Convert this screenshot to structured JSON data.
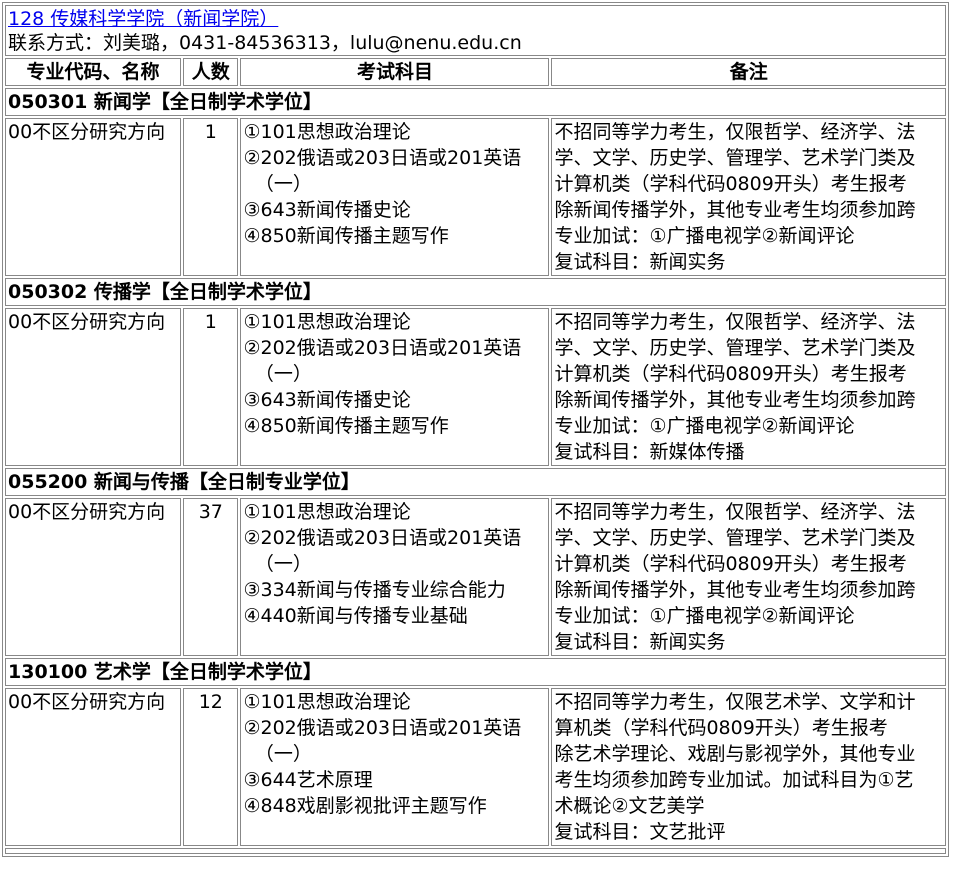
{
  "dept": {
    "link_text": "128 传媒科学学院（新闻学院）",
    "contact": "联系方式：刘美璐，0431-84536313，lulu@nenu.edu.cn"
  },
  "columns": [
    "专业代码、名称",
    "人数",
    "考试科目",
    "备注"
  ],
  "majors": [
    {
      "title": "050301 新闻学【全日制学术学位】",
      "direction": "00不区分研究方向",
      "count": "1",
      "subjects": [
        "①101思想政治理论",
        "②202俄语或203日语或201英语",
        "（一）",
        "③643新闻传播史论",
        "④850新闻传播主题写作"
      ],
      "notes": [
        "不招同等学力考生，仅限哲学、经济学、法",
        "学、文学、历史学、管理学、艺术学门类及",
        "计算机类（学科代码0809开头）考生报考",
        "除新闻传播学外，其他专业考生均须参加跨",
        "专业加试：①广播电视学②新闻评论",
        "复试科目：新闻实务"
      ]
    },
    {
      "title": "050302 传播学【全日制学术学位】",
      "direction": "00不区分研究方向",
      "count": "1",
      "subjects": [
        "①101思想政治理论",
        "②202俄语或203日语或201英语",
        "（一）",
        "③643新闻传播史论",
        "④850新闻传播主题写作"
      ],
      "notes": [
        "不招同等学力考生，仅限哲学、经济学、法",
        "学、文学、历史学、管理学、艺术学门类及",
        "计算机类（学科代码0809开头）考生报考",
        "除新闻传播学外，其他专业考生均须参加跨",
        "专业加试：①广播电视学②新闻评论",
        "复试科目：新媒体传播"
      ]
    },
    {
      "title": "055200 新闻与传播【全日制专业学位】",
      "direction": "00不区分研究方向",
      "count": "37",
      "subjects": [
        "①101思想政治理论",
        "②202俄语或203日语或201英语",
        "（一）",
        "③334新闻与传播专业综合能力",
        "④440新闻与传播专业基础"
      ],
      "notes": [
        "不招同等学力考生，仅限哲学、经济学、法",
        "学、文学、历史学、管理学、艺术学门类及",
        "计算机类（学科代码0809开头）考生报考",
        "除新闻传播学外，其他专业考生均须参加跨",
        "专业加试：①广播电视学②新闻评论",
        "复试科目：新闻实务"
      ]
    },
    {
      "title": "130100 艺术学【全日制学术学位】",
      "direction": "00不区分研究方向",
      "count": "12",
      "subjects": [
        "①101思想政治理论",
        "②202俄语或203日语或201英语",
        "（一）",
        "③644艺术原理",
        "④848戏剧影视批评主题写作"
      ],
      "notes": [
        "不招同等学力考生，仅限艺术学、文学和计",
        "算机类（学科代码0809开头）考生报考",
        "除艺术学理论、戏剧与影视学外，其他专业",
        "考生均须参加跨专业加试。加试科目为①艺",
        "术概论②文艺美学",
        "复试科目：文艺批评"
      ]
    }
  ]
}
